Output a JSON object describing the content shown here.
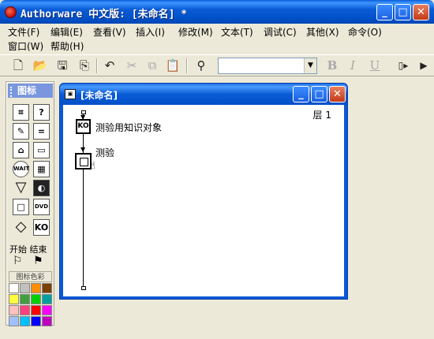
{
  "window": {
    "title": "Authorware 中文版: [未命名] *"
  },
  "menus": [
    {
      "label": "文件(F)"
    },
    {
      "label": "编辑(E)"
    },
    {
      "label": "查看(V)"
    },
    {
      "label": "插入(I)"
    },
    {
      "label": "修改(M)"
    },
    {
      "label": "文本(T)"
    },
    {
      "label": "调试(C)"
    },
    {
      "label": "其他(X)"
    },
    {
      "label": "命令(O)"
    },
    {
      "label": "窗口(W)"
    },
    {
      "label": "帮助(H)"
    }
  ],
  "toolbar": {
    "font_combo_value": "",
    "bold": "B",
    "italic": "I",
    "underline": "U"
  },
  "palette": {
    "title": "图标",
    "icons": [
      {
        "name": "display-icon",
        "glyph": "⌗"
      },
      {
        "name": "motion-icon",
        "glyph": "?"
      },
      {
        "name": "erase-icon",
        "glyph": "✎"
      },
      {
        "name": "wait-icon",
        "glyph": "="
      },
      {
        "name": "navigate-icon",
        "glyph": "⌂"
      },
      {
        "name": "framework-icon",
        "glyph": "▭"
      },
      {
        "name": "decision-icon",
        "glyph": "WAIT"
      },
      {
        "name": "interaction-icon",
        "glyph": "▦"
      },
      {
        "name": "calculation-icon",
        "glyph": "▽"
      },
      {
        "name": "map-icon",
        "glyph": "◐"
      },
      {
        "name": "digital-movie-icon",
        "glyph": "□"
      },
      {
        "name": "sound-icon",
        "glyph": "DVD"
      },
      {
        "name": "video-icon",
        "glyph": "◇"
      },
      {
        "name": "knowledge-object-icon",
        "glyph": "KO"
      }
    ],
    "start_end_label": "开始 结束",
    "start_flag": "⚐",
    "end_flag": "⚑",
    "color_label": "图标色彩",
    "colors": [
      "#ffffff",
      "#c0c0c0",
      "#ff8c00",
      "#7b3f00",
      "#ffff40",
      "#40a040",
      "#00d000",
      "#00a0a0",
      "#ffc0c0",
      "#ff4080",
      "#ff0000",
      "#ff00ff",
      "#a0c0ff",
      "#00c0ff",
      "#0000ff",
      "#c000c0"
    ]
  },
  "design_window": {
    "title": "[未命名]",
    "layer_label": "层 1",
    "nodes": [
      {
        "label": "测验用知识对象",
        "icon": "KO"
      },
      {
        "label": "测验"
      }
    ]
  }
}
